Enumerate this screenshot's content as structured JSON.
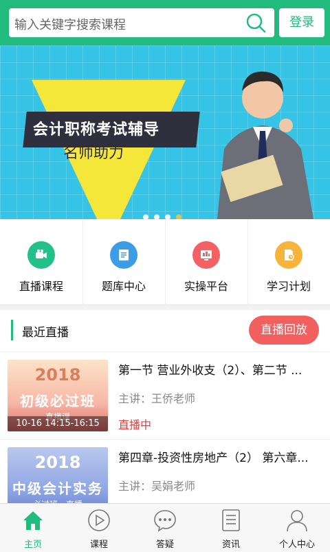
{
  "header": {
    "search_placeholder": "输入关键字搜索课程",
    "login_label": "登录"
  },
  "banner": {
    "title": "会计职称考试辅导",
    "subtitle": "名师助力",
    "page_count": 4,
    "active_page": 4
  },
  "quick_links": [
    {
      "label": "直播课程",
      "icon": "video-camera-icon",
      "color": "#22c18a"
    },
    {
      "label": "题库中心",
      "icon": "question-bank-icon",
      "color": "#3c9ce6"
    },
    {
      "label": "实操平台",
      "icon": "practice-platform-icon",
      "color": "#f26163"
    },
    {
      "label": "学习计划",
      "icon": "study-plan-icon",
      "color": "#f7b33a"
    }
  ],
  "recent_live": {
    "title": "最近直播",
    "replay_label": "直播回放"
  },
  "courses": [
    {
      "title": "第一节 营业外收支（2）、第二节 ...",
      "teacher": "主讲：王侨老师",
      "status": "直播中",
      "thumb_year": "2018",
      "thumb_title": "初级必过班",
      "thumb_tag": "直播课",
      "thumb_time": "10-16    14:15-16:15"
    },
    {
      "title": "第四章-投资性房地产（2） 第六章...",
      "teacher": "主讲：吴娟老师",
      "status": "",
      "thumb_year": "2018",
      "thumb_title": "中级会计实务",
      "thumb_tag": "必过班・直播",
      "thumb_time": ""
    }
  ],
  "tabbar": [
    {
      "label": "主页",
      "icon": "home-icon",
      "active": true
    },
    {
      "label": "课程",
      "icon": "play-circle-icon",
      "active": false
    },
    {
      "label": "答疑",
      "icon": "chat-bubble-icon",
      "active": false
    },
    {
      "label": "资讯",
      "icon": "news-list-icon",
      "active": false
    },
    {
      "label": "个人中心",
      "icon": "user-icon",
      "active": false
    }
  ],
  "colors": {
    "brand": "#22bb7e",
    "live": "#e53b3b",
    "replay": "#f25f5f"
  }
}
